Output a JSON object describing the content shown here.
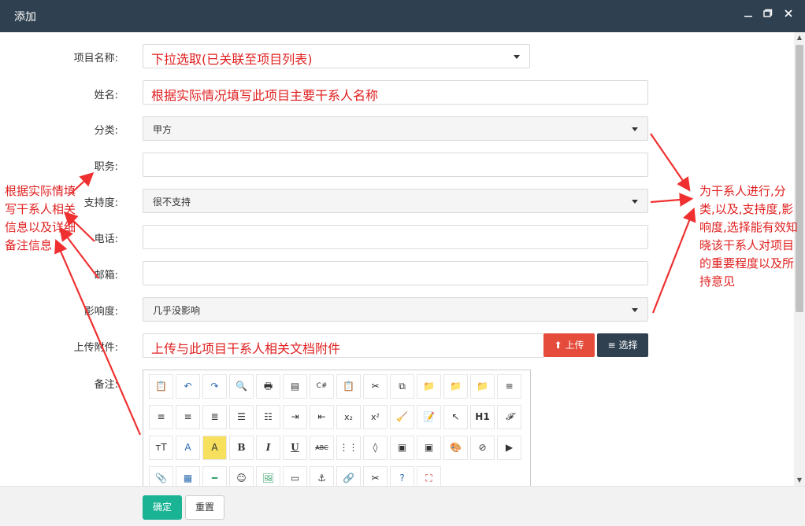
{
  "window": {
    "title": "添加",
    "minimize_icon": "minimize-icon",
    "restore_icon": "restore-icon",
    "close_icon": "close-icon"
  },
  "form": {
    "project_name": {
      "label": "项目名称:",
      "value": "下拉选取(已关联至项目列表)"
    },
    "name": {
      "label": "姓名:",
      "value": "根据实际情况填写此项目主要干系人名称"
    },
    "category": {
      "label": "分类:",
      "value": "甲方"
    },
    "position": {
      "label": "职务:",
      "value": ""
    },
    "support": {
      "label": "支持度:",
      "value": "很不支持"
    },
    "phone": {
      "label": "电话:",
      "value": ""
    },
    "email": {
      "label": "邮箱:",
      "value": ""
    },
    "influence": {
      "label": "影响度:",
      "value": "几乎没影响"
    },
    "attachment": {
      "label": "上传附件:",
      "value": "上传与此项目干系人相关文档附件",
      "upload_label": "上传",
      "select_label": "选择"
    },
    "remarks": {
      "label": "备注:"
    }
  },
  "editor_toolbar": {
    "row1": [
      "source-icon",
      "undo-icon",
      "redo-icon",
      "preview-icon",
      "print-icon",
      "template-icon",
      "code-icon",
      "paste-icon",
      "cut-icon",
      "copy-icon",
      "paste-plain-icon",
      "paste-text-icon",
      "paste-word-icon",
      "align-left-icon"
    ],
    "row2": [
      "align-center-icon",
      "align-right-icon",
      "justify-icon",
      "ordered-list-icon",
      "unordered-list-icon",
      "indent-icon",
      "outdent-icon",
      "subscript-icon",
      "superscript-icon",
      "clear-format-icon",
      "select-all-icon",
      "pointer-icon",
      "heading-icon",
      "font-family-icon"
    ],
    "row3": [
      "font-size-icon",
      "font-color-icon",
      "highlight-icon",
      "bold-icon",
      "italic-icon",
      "underline-icon",
      "strikethrough-icon",
      "line-height-icon",
      "eraser-icon",
      "image-insert-icon",
      "multi-image-icon",
      "emoticon-icon",
      "flash-icon",
      "media-icon"
    ],
    "row4": [
      "attachment-icon",
      "table-icon",
      "horizontal-rule-icon",
      "smiley-icon",
      "image-icon",
      "page-break-icon",
      "anchor-icon",
      "link-icon",
      "unlink-icon",
      "help-icon",
      "fullscreen-icon"
    ],
    "labels": {
      "heading": "H1",
      "bold": "B",
      "italic": "I",
      "underline": "U",
      "strike": "ABC",
      "font_size": "тT",
      "font_color": "A",
      "highlight": "A"
    }
  },
  "footer": {
    "ok_label": "确定",
    "reset_label": "重置"
  },
  "annotations": {
    "left": "根据实际情填写干系人相关信息以及详细备注信息",
    "right": "为干系人进行,分类,以及,支持度,影响度,选择能有效知晓该干系人对项目的重要程度以及所持意见"
  },
  "colors": {
    "titlebar": "#2f4050",
    "upload": "#e54c3c",
    "select": "#2f4050",
    "ok": "#1ab394",
    "annotation": "#e02020"
  }
}
